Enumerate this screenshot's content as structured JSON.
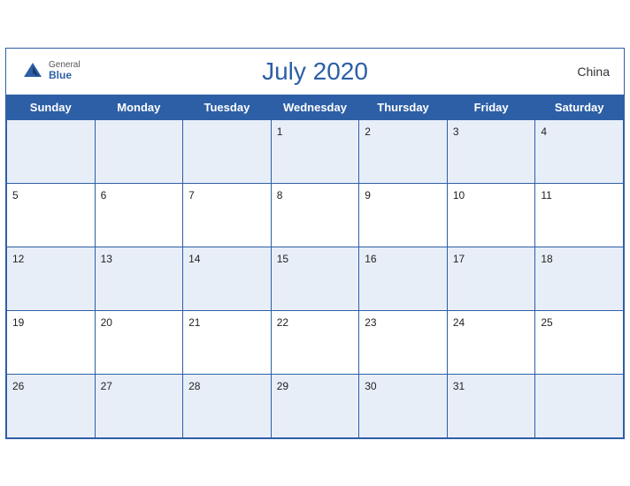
{
  "header": {
    "title": "July 2020",
    "brand_general": "General",
    "brand_blue": "Blue",
    "country": "China"
  },
  "weekdays": [
    "Sunday",
    "Monday",
    "Tuesday",
    "Wednesday",
    "Thursday",
    "Friday",
    "Saturday"
  ],
  "weeks": [
    [
      null,
      null,
      null,
      1,
      2,
      3,
      4
    ],
    [
      5,
      6,
      7,
      8,
      9,
      10,
      11
    ],
    [
      12,
      13,
      14,
      15,
      16,
      17,
      18
    ],
    [
      19,
      20,
      21,
      22,
      23,
      24,
      25
    ],
    [
      26,
      27,
      28,
      29,
      30,
      31,
      null
    ]
  ]
}
